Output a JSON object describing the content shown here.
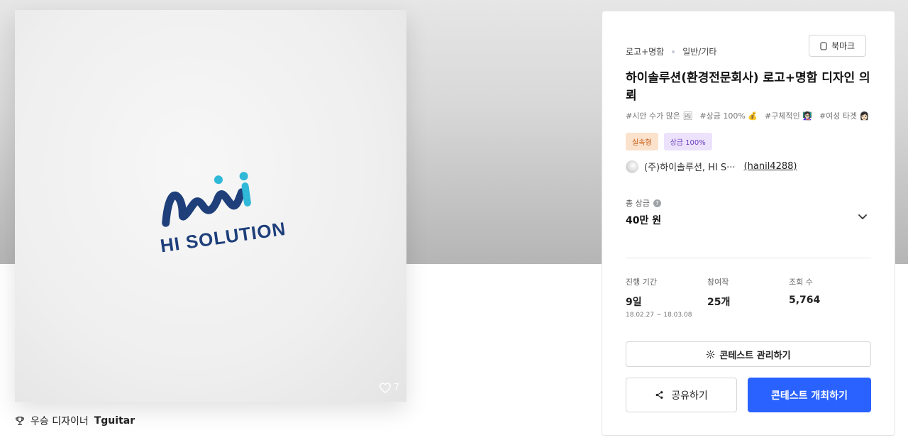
{
  "artwork": {
    "logo_text": "HI SOLUTION",
    "like_count": "7"
  },
  "winner": {
    "label": "우승 디자이너",
    "name": "Tguitar"
  },
  "contest": {
    "category": "로고+명함",
    "subcategory": "일반/기타",
    "bookmark_label": "북마크",
    "title": "하이솔루션(환경전문회사) 로고+명함 디자인 의뢰",
    "tags": [
      "#시안 수가 많은 🖼",
      "#상금 100% 💰",
      "#구체적인 👩🏻‍🏫",
      "#여성 타겟 👩🏻"
    ],
    "badges": [
      "실속형",
      "상금 100%"
    ],
    "host_name": "(주)하이솔루션, HI S···",
    "host_id": "(hanil4288)",
    "prize_label": "총 상금",
    "prize_value": "40만 원",
    "stats": {
      "period_label": "진행 기간",
      "period_value": "9일",
      "period_range": "18.02.27 ~ 18.03.08",
      "entries_label": "참여작",
      "entries_value": "25개",
      "views_label": "조회 수",
      "views_value": "5,764"
    },
    "buttons": {
      "manage": "콘테스트 관리하기",
      "share": "공유하기",
      "open": "콘테스트 개최하기"
    }
  },
  "colors": {
    "primary": "#2962ff",
    "logo_dark": "#1e3f7a",
    "logo_teal": "#2fb8d8"
  }
}
